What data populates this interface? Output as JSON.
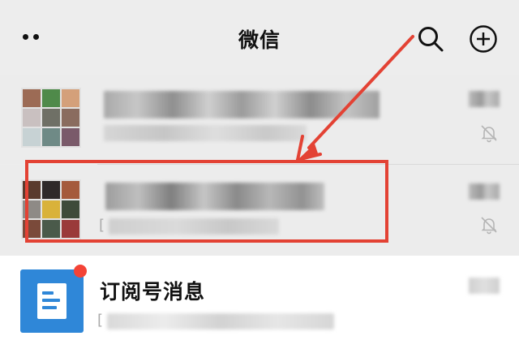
{
  "header": {
    "title": "微信",
    "more_icon": "more-dots-icon",
    "search_icon": "search-icon",
    "add_icon": "plus-circle-icon"
  },
  "chats": [
    {
      "avatar": "group-grid-avatar",
      "name": "",
      "preview": "",
      "muted": true
    },
    {
      "avatar": "group-grid-avatar",
      "name": "",
      "preview_prefix": "[",
      "muted": true,
      "highlighted": true
    }
  ],
  "subscription": {
    "title": "订阅号消息",
    "preview_prefix": "[",
    "icon": "subscription-doc-icon",
    "unread_dot": true
  },
  "annotation": {
    "box_color": "#e34234",
    "arrow_color": "#e34234"
  }
}
